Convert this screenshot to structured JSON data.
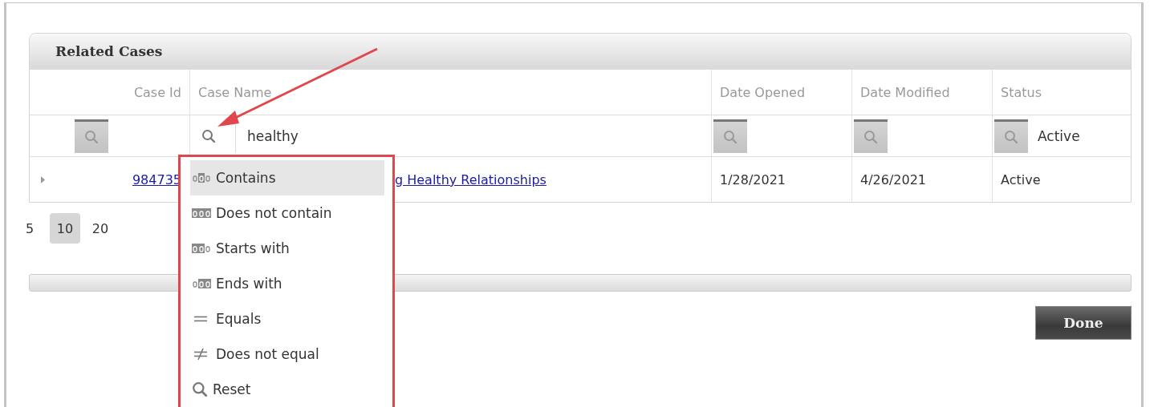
{
  "panel": {
    "title": "Related Cases"
  },
  "table": {
    "columns": [
      {
        "label": "Case Id"
      },
      {
        "label": "Case Name"
      },
      {
        "label": "Date Opened"
      },
      {
        "label": "Date Modified"
      },
      {
        "label": "Status"
      }
    ],
    "filters": [
      {
        "active": false
      },
      {
        "value": "healthy",
        "active": true
      },
      {
        "active": false
      },
      {
        "active": false
      },
      {
        "value": "Active",
        "active": false
      }
    ],
    "rows": [
      {
        "case_id": "984735",
        "case_name": "g Healthy Relationships",
        "date_opened": "1/28/2021",
        "date_modified": "4/26/2021",
        "status": "Active"
      }
    ]
  },
  "page_sizes": [
    {
      "label": "5",
      "selected": false
    },
    {
      "label": "10",
      "selected": true
    },
    {
      "label": "20",
      "selected": false
    }
  ],
  "done_button": "Done",
  "filter_menu": [
    {
      "kind": "contains",
      "label": "Contains",
      "selected": true
    },
    {
      "kind": "not_contains",
      "label": "Does not contain",
      "selected": false
    },
    {
      "kind": "starts",
      "label": "Starts with",
      "selected": false
    },
    {
      "kind": "ends",
      "label": "Ends with",
      "selected": false
    },
    {
      "kind": "equals",
      "label": "Equals",
      "selected": false
    },
    {
      "kind": "not_equal",
      "label": "Does not equal",
      "selected": false
    },
    {
      "kind": "reset",
      "label": "Reset",
      "selected": false
    }
  ]
}
